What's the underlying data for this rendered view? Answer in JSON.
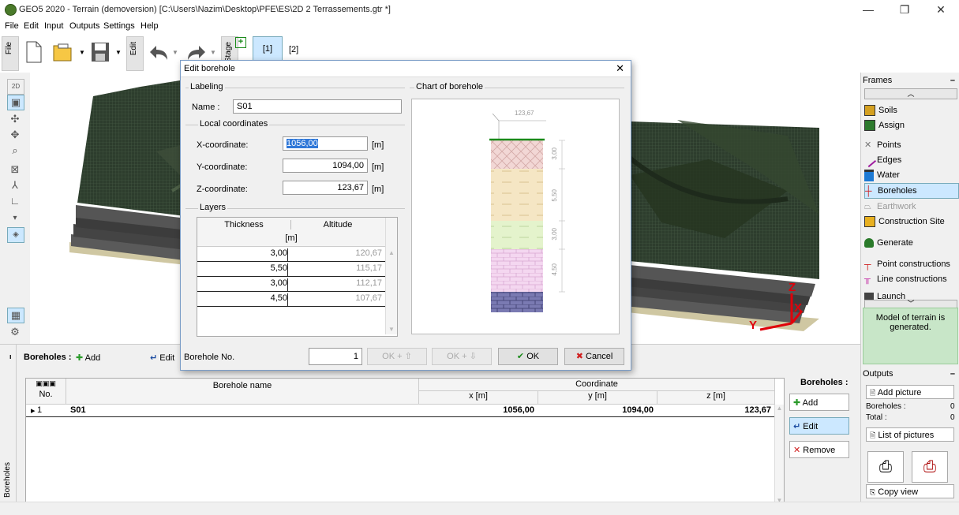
{
  "window": {
    "title": "GEO5 2020 - Terrain (demoversion) [C:\\Users\\Nazim\\Desktop\\PFE\\ES\\2D 2 Terrassements.gtr *]",
    "minimize": "—",
    "restore": "❐",
    "close": "✕"
  },
  "menu": [
    "File",
    "Edit",
    "Input",
    "Outputs",
    "Settings",
    "Help"
  ],
  "toolbar": {
    "file_tab": "File",
    "edit_tab": "Edit",
    "stage_tab": "Stage",
    "stages": [
      "[1]",
      "[2]"
    ]
  },
  "left_tools": {
    "view2d": "2D"
  },
  "viewport": {
    "axis_z": "Z",
    "axis_x": "X",
    "axis_y": "Y"
  },
  "right_panel": {
    "frames_title": "Frames",
    "frames_collapse": "–",
    "items": [
      {
        "label": "Soils",
        "icon": "soils-icon"
      },
      {
        "label": "Assign",
        "icon": "assign-icon"
      },
      {
        "label": "Points",
        "icon": "points-icon"
      },
      {
        "label": "Edges",
        "icon": "edges-icon"
      },
      {
        "label": "Water",
        "icon": "water-icon"
      },
      {
        "label": "Boreholes",
        "icon": "boreholes-icon"
      },
      {
        "label": "Earthwork",
        "icon": "earthwork-icon"
      },
      {
        "label": "Construction Site",
        "icon": "construction-site-icon"
      },
      {
        "label": "Generate",
        "icon": "generate-icon"
      },
      {
        "label": "Point constructions",
        "icon": "point-constructions-icon"
      },
      {
        "label": "Line constructions",
        "icon": "line-constructions-icon"
      },
      {
        "label": "Launch",
        "icon": "launch-icon"
      }
    ],
    "status_message": "Model of terrain is generated.",
    "outputs_title": "Outputs",
    "add_picture": "Add picture",
    "boreholes_label": "Boreholes :",
    "boreholes_count": "0",
    "total_label": "Total :",
    "total_count": "0",
    "list_of_pictures": "List of pictures",
    "copy_view": "Copy view"
  },
  "bottom_panel": {
    "side_label": "Boreholes",
    "title": "Boreholes :",
    "add_label": "Add",
    "edit_label": "Edit",
    "columns": {
      "no": "No.",
      "name": "Borehole name",
      "coordinate": "Coordinate",
      "x": "x [m]",
      "y": "y [m]",
      "z": "z [m]"
    },
    "rows": [
      {
        "marker": "▸",
        "no": "1",
        "name": "S01",
        "x": "1056,00",
        "y": "1094,00",
        "z": "123,67"
      }
    ],
    "side_title": "Boreholes :",
    "side_add": "Add",
    "side_edit": "Edit",
    "side_remove": "Remove"
  },
  "dialog": {
    "title": "Edit borehole",
    "close": "✕",
    "labeling_group": "Labeling",
    "name_label": "Name :",
    "name_value": "S01",
    "local_coords_group": "Local coordinates",
    "x_label": "X-coordinate:",
    "x_value": "1056,00",
    "y_label": "Y-coordinate:",
    "y_value": "1094,00",
    "z_label": "Z-coordinate:",
    "z_value": "123,67",
    "unit_m": "[m]",
    "layers_group": "Layers",
    "col_thickness": "Thickness",
    "col_altitude": "Altitude",
    "col_unit": "[m]",
    "layers": [
      {
        "thickness": "3,00",
        "altitude": "120,67"
      },
      {
        "thickness": "5,50",
        "altitude": "115,17"
      },
      {
        "thickness": "3,00",
        "altitude": "112,17"
      },
      {
        "thickness": "4,50",
        "altitude": "107,67"
      }
    ],
    "chart_group": "Chart of borehole",
    "chart_top_altitude": "123,67",
    "chart_thickness_labels": [
      "3,00",
      "5,50",
      "3,00",
      "4,50"
    ],
    "borehole_no_label": "Borehole No.",
    "borehole_no_value": "1",
    "ok_up": "OK + ⇧",
    "ok_down": "OK + ⇩",
    "ok": "OK",
    "cancel": "Cancel"
  }
}
